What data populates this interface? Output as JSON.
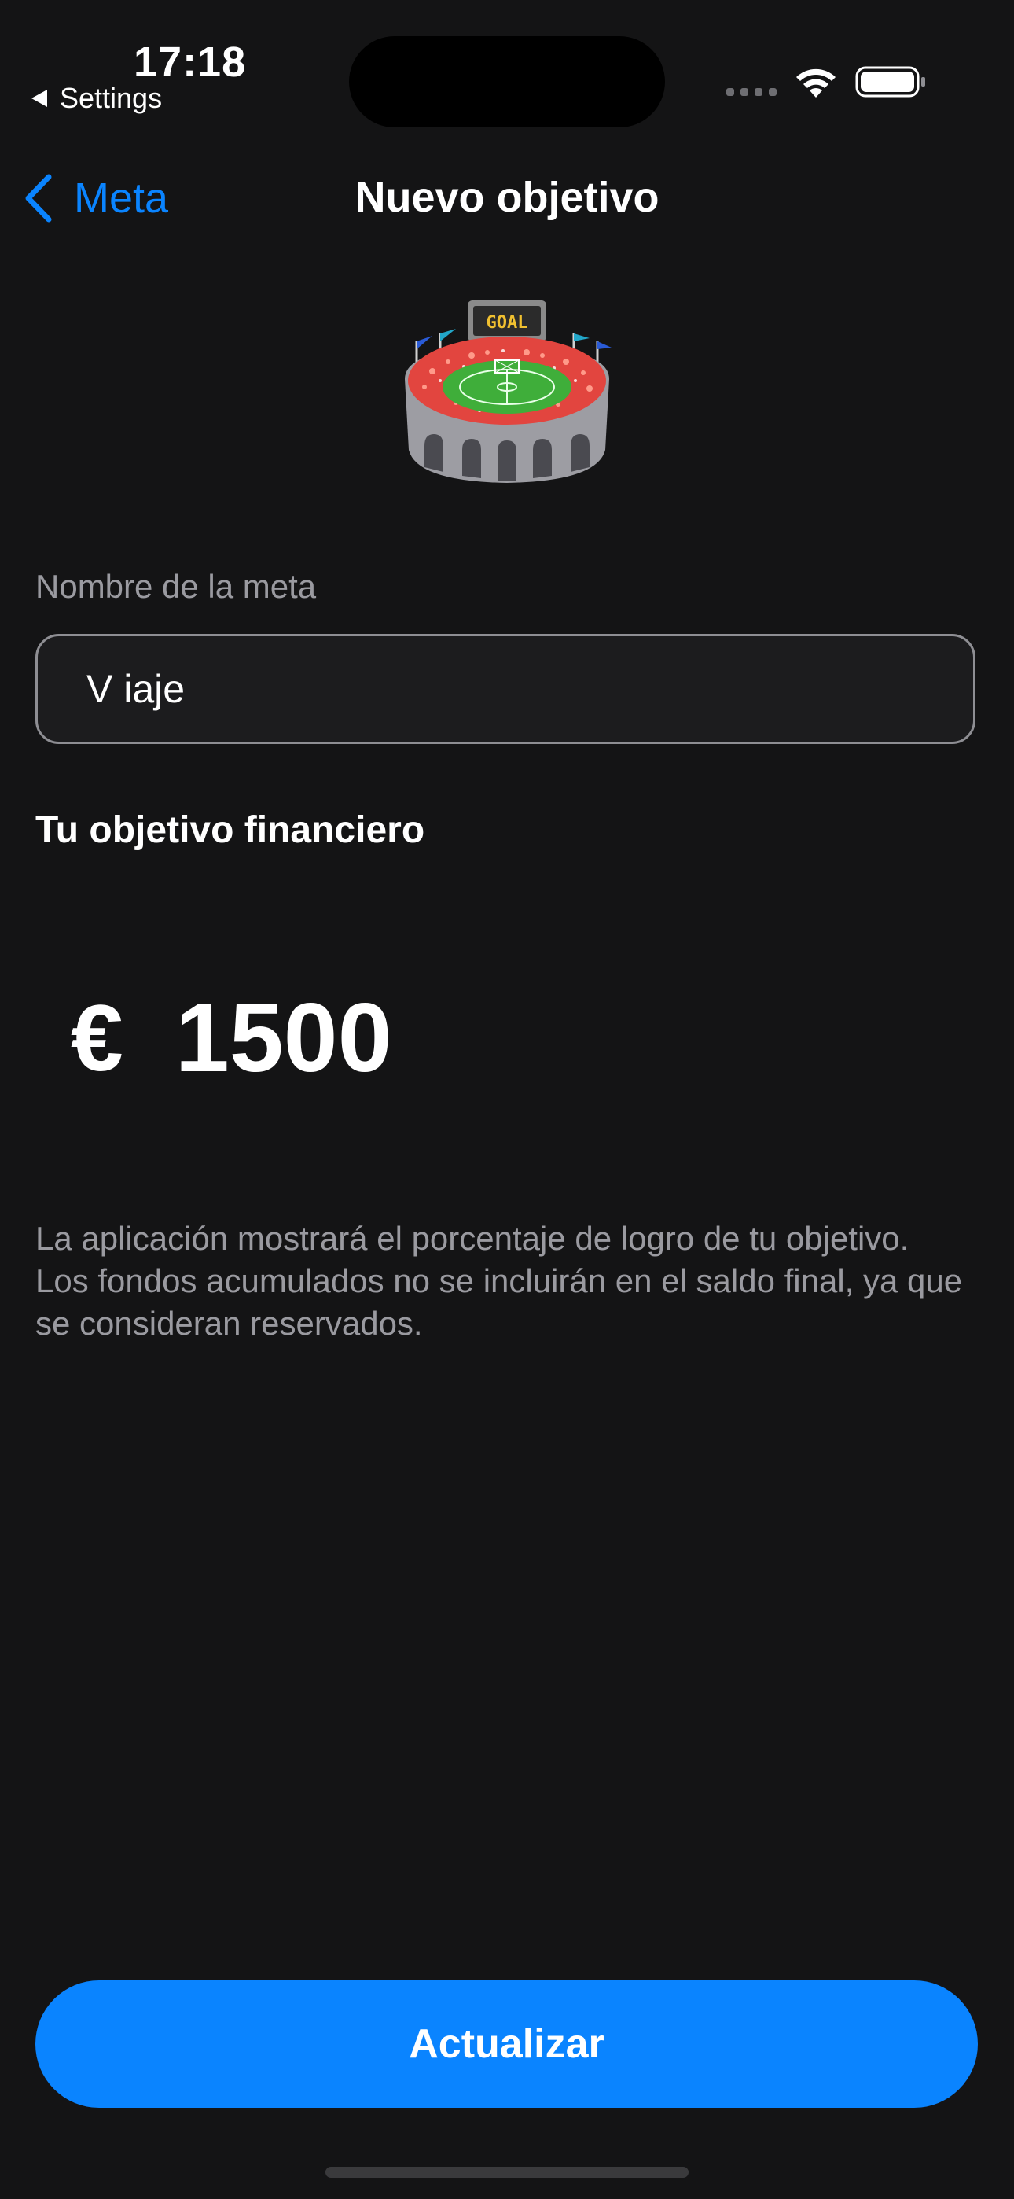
{
  "status_bar": {
    "time": "17:18",
    "back_app": "Settings",
    "icons": [
      "signal-dots-icon",
      "wifi-icon",
      "battery-icon"
    ]
  },
  "nav": {
    "back_label": "Meta",
    "title": "Nuevo objetivo"
  },
  "goal_icon": "stadium-icon",
  "form": {
    "name_label": "Nombre de la meta",
    "name_value": "V iaje",
    "target_title": "Tu objetivo financiero",
    "currency_symbol": "€",
    "amount": "1500",
    "note": "La aplicación mostrará el porcentaje de logro de tu objetivo. Los fondos acumulados no se incluirán en el saldo final, ya que se consideran reservados."
  },
  "actions": {
    "update_label": "Actualizar"
  },
  "colors": {
    "background": "#141415",
    "accent": "#0a84ff",
    "secondary_text": "#9a9aa0"
  }
}
